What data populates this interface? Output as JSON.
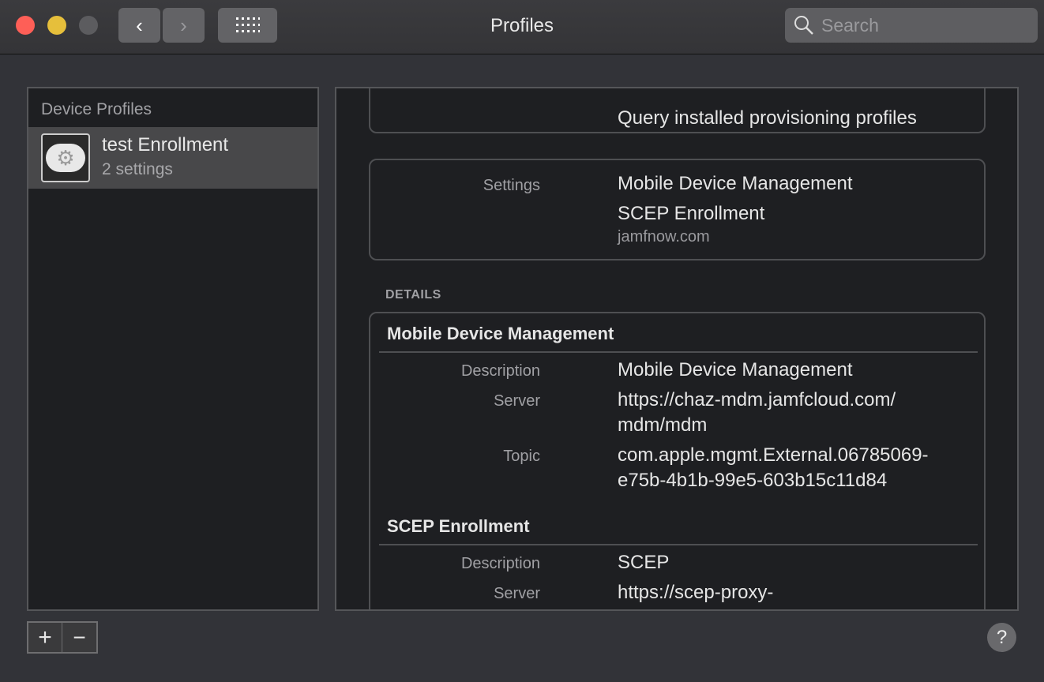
{
  "window": {
    "title": "Profiles",
    "search_placeholder": "Search",
    "colors": {
      "close": "#fe5f57",
      "minimize": "#e6bf3b",
      "zoom": "#5c5c5f"
    }
  },
  "sidebar": {
    "header": "Device Profiles",
    "items": [
      {
        "name": "test Enrollment",
        "subtitle": "2 settings",
        "icon": "profile-gear-cloud-icon"
      }
    ]
  },
  "top_card": {
    "value": "Query installed provisioning profiles"
  },
  "summary": {
    "label": "Settings",
    "values": [
      "Mobile Device Management",
      "SCEP Enrollment"
    ],
    "domain": "jamfnow.com"
  },
  "details": {
    "heading": "DETAILS",
    "sections": [
      {
        "title": "Mobile Device Management",
        "rows": [
          {
            "label": "Description",
            "value": "Mobile Device Management"
          },
          {
            "label": "Server",
            "value": "https://chaz-mdm.jamfcloud.com/\nmdm/mdm"
          },
          {
            "label": "Topic",
            "value": "com.apple.mgmt.External.06785069-\ne75b-4b1b-99e5-603b15c11d84"
          }
        ]
      },
      {
        "title": "SCEP Enrollment",
        "rows": [
          {
            "label": "Description",
            "value": "SCEP"
          },
          {
            "label": "Server",
            "value": "https://scep-proxy-"
          }
        ]
      }
    ]
  },
  "footer": {
    "add": "+",
    "remove": "−",
    "help": "?"
  }
}
